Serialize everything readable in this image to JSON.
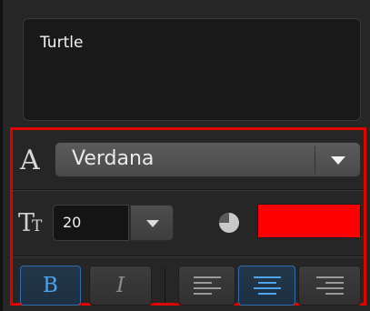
{
  "text_box": {
    "value": "Turtle"
  },
  "font": {
    "icon": "font-family-icon",
    "glyph": "A",
    "value": "Verdana",
    "dropdown_icon": "chevron-down-icon"
  },
  "size": {
    "icon": "font-size-icon",
    "glyph_big": "T",
    "glyph_small": "T",
    "value": "20",
    "dropdown_icon": "chevron-down-icon"
  },
  "color": {
    "opacity_icon": "opacity-icon",
    "swatch": "#ff0000"
  },
  "style_buttons": [
    {
      "name": "bold",
      "label": "B",
      "active": true
    },
    {
      "name": "italic",
      "label": "I",
      "active": false
    }
  ],
  "align_buttons": [
    {
      "name": "align-left",
      "icon": "align-left-icon",
      "active": false
    },
    {
      "name": "align-center",
      "icon": "align-center-icon",
      "active": true
    },
    {
      "name": "align-right",
      "icon": "align-right-icon",
      "active": false
    }
  ],
  "colors": {
    "highlight": "#e00000",
    "active_accent": "#4fa3ea"
  }
}
